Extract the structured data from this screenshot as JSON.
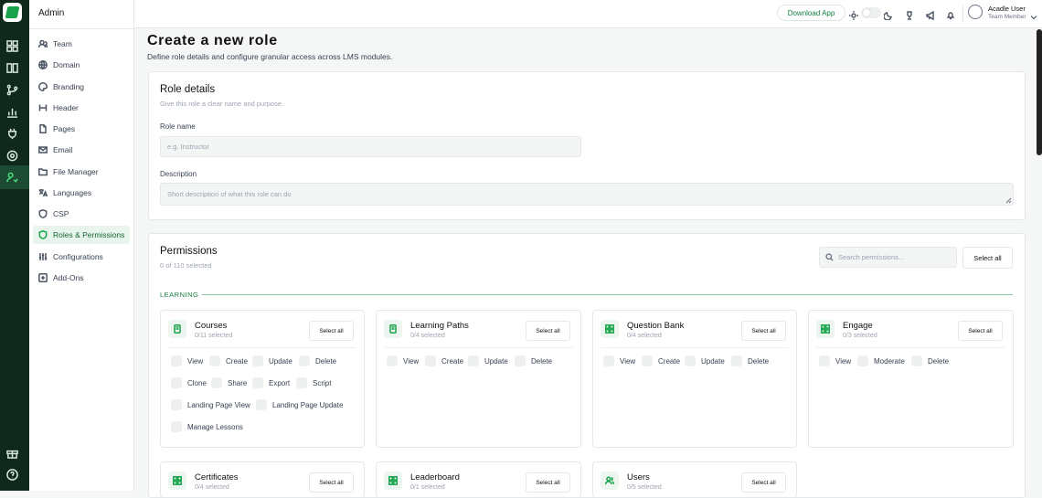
{
  "sidebar": {
    "title": "Admin",
    "items": [
      {
        "label": "Team",
        "icon": "team-icon"
      },
      {
        "label": "Domain",
        "icon": "globe-icon"
      },
      {
        "label": "Branding",
        "icon": "palette-icon"
      },
      {
        "label": "Header",
        "icon": "header-icon"
      },
      {
        "label": "Pages",
        "icon": "file-icon"
      },
      {
        "label": "Email",
        "icon": "mail-icon"
      },
      {
        "label": "File Manager",
        "icon": "folder-icon"
      },
      {
        "label": "Languages",
        "icon": "languages-icon"
      },
      {
        "label": "CSP",
        "icon": "shield-icon"
      },
      {
        "label": "Roles & Permissions",
        "icon": "shield-icon",
        "active": true
      },
      {
        "label": "Configurations",
        "icon": "sliders-icon"
      },
      {
        "label": "Add-Ons",
        "icon": "plus-square-icon"
      }
    ]
  },
  "topbar": {
    "download_label": "Download App",
    "user_name": "Acadle User",
    "user_role": "Team Member"
  },
  "header": {
    "title": "Create a new role",
    "subtitle": "Define role details and configure granular access across LMS modules."
  },
  "role_details": {
    "title": "Role details",
    "subtitle": "Give this role a clear name and purpose.",
    "name_label": "Role name",
    "name_placeholder": "e.g. Instructor",
    "desc_label": "Description",
    "desc_placeholder": "Short description of what this role can do"
  },
  "permissions": {
    "title": "Permissions",
    "count_text": "0 of 110 selected",
    "search_placeholder": "Search permissions...",
    "select_all_label": "Select all",
    "section_label": "LEARNING",
    "modules": [
      {
        "name": "Courses",
        "count": "0/11 selected",
        "icon": "book-icon",
        "select_label": "Select all",
        "perms": [
          "View",
          "Create",
          "Update",
          "Delete",
          "Clone",
          "Share",
          "Export",
          "Script",
          "Landing Page View",
          "Landing Page Update",
          "Manage Lessons"
        ]
      },
      {
        "name": "Learning Paths",
        "count": "0/4 selected",
        "icon": "book-icon",
        "select_label": "Select all",
        "perms": [
          "View",
          "Create",
          "Update",
          "Delete"
        ]
      },
      {
        "name": "Question Bank",
        "count": "0/4 selected",
        "icon": "grid-icon",
        "select_label": "Select all",
        "perms": [
          "View",
          "Create",
          "Update",
          "Delete"
        ]
      },
      {
        "name": "Engage",
        "count": "0/3 selected",
        "icon": "grid-icon",
        "select_label": "Select all",
        "perms": [
          "View",
          "Moderate",
          "Delete"
        ]
      },
      {
        "name": "Certificates",
        "count": "0/4 selected",
        "icon": "grid-icon",
        "select_label": "Select all",
        "perms": []
      },
      {
        "name": "Leaderboard",
        "count": "0/1 selected",
        "icon": "grid-icon",
        "select_label": "Select all",
        "perms": []
      },
      {
        "name": "Users",
        "count": "0/5 selected",
        "icon": "users-icon",
        "select_label": "Select all",
        "perms": []
      }
    ]
  },
  "colors": {
    "accent": "#16a34a",
    "rail": "#0f2a1d"
  }
}
